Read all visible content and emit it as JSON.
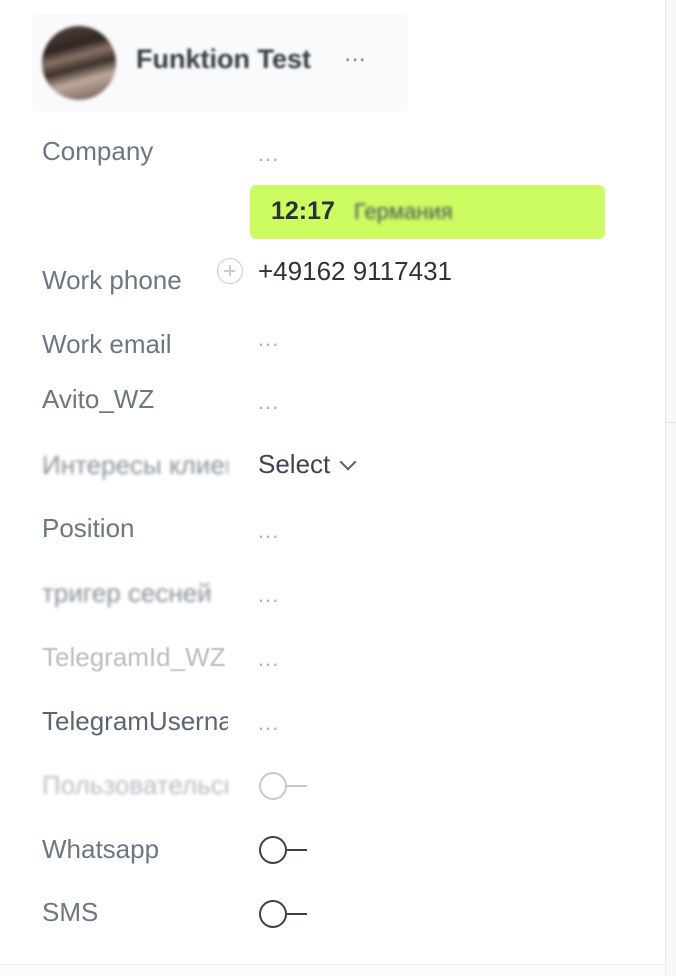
{
  "contact": {
    "name": "Funktion Test",
    "more_label": "···"
  },
  "time_badge": {
    "time": "12:17",
    "country": "Германия",
    "color": "#ccfb62"
  },
  "fields": {
    "company": {
      "label": "Company",
      "value": "..."
    },
    "work_phone": {
      "label": "Work phone",
      "value": "+49162 9117431"
    },
    "work_email": {
      "label": "Work email",
      "value": "..."
    },
    "avito": {
      "label": "Avito_WZ",
      "value": "..."
    },
    "interests": {
      "label": "Интересы клиента",
      "value": "Select"
    },
    "position": {
      "label": "Position",
      "value": "..."
    },
    "trigger": {
      "label": "тригер сесней",
      "value": "..."
    },
    "telegram_id": {
      "label": "TelegramId_WZ",
      "value": "..."
    },
    "telegram_username": {
      "label": "TelegramUsername",
      "value": "..."
    },
    "user_consent": {
      "label": "Пользовательское",
      "enabled": false
    },
    "whatsapp": {
      "label": "Whatsapp",
      "enabled": false
    },
    "sms": {
      "label": "SMS",
      "enabled": false
    }
  },
  "icons": {
    "add_phone": "plus-circle-icon",
    "select_chevron": "chevron-down-icon"
  }
}
